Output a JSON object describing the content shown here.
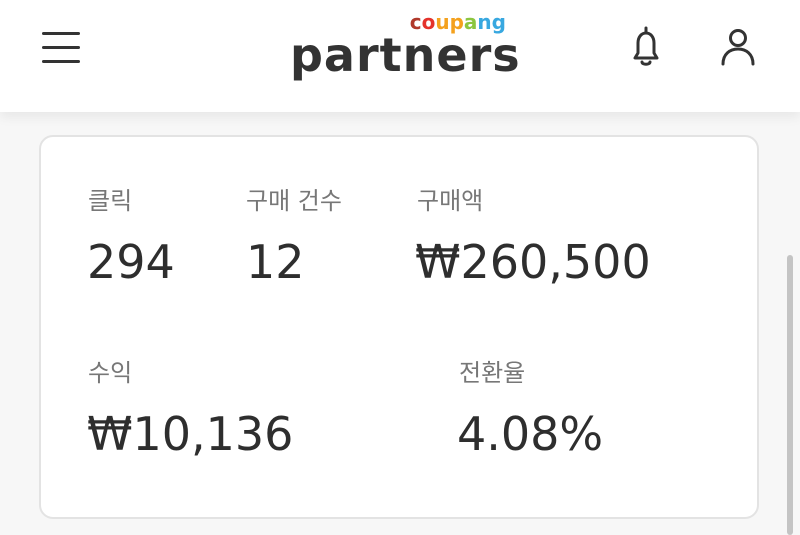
{
  "header": {
    "logo_brand": "coupang",
    "logo_product": "partners",
    "icons": [
      "menu-icon",
      "bell-icon",
      "user-icon"
    ],
    "brand_colors": [
      "#e4322b",
      "#f4a11d",
      "#8cc63f",
      "#38a8e0"
    ]
  },
  "stats": {
    "clicks": {
      "label": "클릭",
      "value": "294"
    },
    "orders": {
      "label": "구매 건수",
      "value": "12"
    },
    "amount": {
      "label": "구매액",
      "value": "₩260,500"
    },
    "revenue": {
      "label": "수익",
      "value": "₩10,136"
    },
    "conversion": {
      "label": "전환율",
      "value": "4.08%"
    }
  }
}
